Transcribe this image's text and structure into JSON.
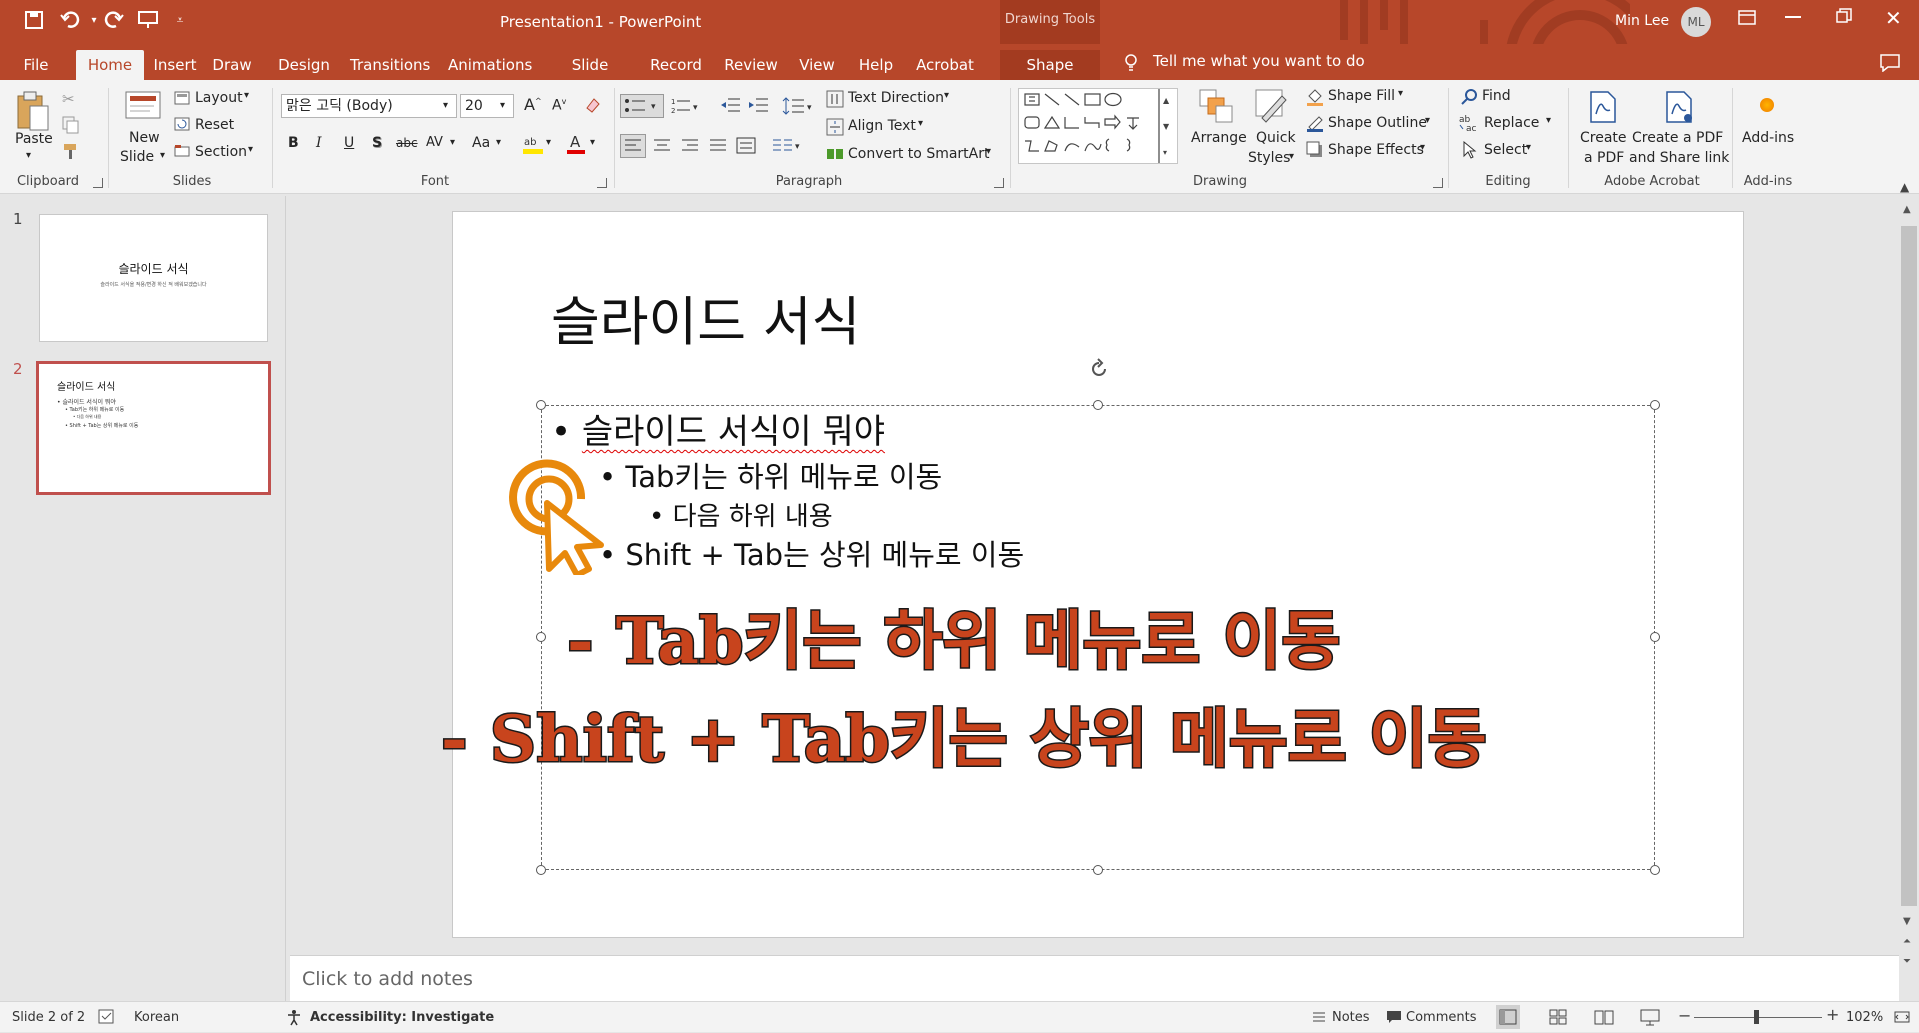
{
  "window": {
    "title": "Presentation1  -  PowerPoint",
    "context_title": "Drawing Tools",
    "user_name": "Min Lee",
    "user_initials": "ML"
  },
  "tabs": [
    "File",
    "Home",
    "Insert",
    "Draw",
    "Design",
    "Transitions",
    "Animations",
    "Slide Show",
    "Record",
    "Review",
    "View",
    "Help",
    "Acrobat",
    "Shape Format"
  ],
  "active_tab": "Home",
  "tell_me": "Tell me what you want to do",
  "ribbon": {
    "clipboard": {
      "paste": "Paste",
      "label": "Clipboard"
    },
    "slides": {
      "new_slide_1": "New",
      "new_slide_2": "Slide",
      "layout": "Layout",
      "reset": "Reset",
      "section": "Section",
      "label": "Slides"
    },
    "font": {
      "font_name": "맑은 고딕 (Body)",
      "font_size": "20",
      "label": "Font",
      "char_spacing": "AV",
      "change_case": "Aa",
      "bold": "B",
      "italic": "I",
      "underline": "U",
      "shadow": "S",
      "strike": "abc"
    },
    "paragraph": {
      "text_direction": "Text Direction",
      "align_text": "Align Text",
      "convert_smartart": "Convert to SmartArt",
      "label": "Paragraph"
    },
    "drawing": {
      "arrange": "Arrange",
      "quick_styles_1": "Quick",
      "quick_styles_2": "Styles",
      "shape_fill": "Shape Fill",
      "shape_outline": "Shape Outline",
      "shape_effects": "Shape Effects",
      "label": "Drawing"
    },
    "editing": {
      "find": "Find",
      "replace": "Replace",
      "select": "Select",
      "label": "Editing"
    },
    "acrobat": {
      "create_pdf_1": "Create",
      "create_pdf_2": "a PDF",
      "create_share_1": "Create a PDF",
      "create_share_2": "and Share link",
      "label": "Adobe Acrobat"
    },
    "addins": {
      "addins": "Add-ins",
      "label": "Add-ins"
    }
  },
  "thumbnails": [
    {
      "number": "1",
      "title": "슬라이드 서식",
      "subtitle": "슬라이드 서식을 적용/변경 하신 적 배워보겠습니다"
    },
    {
      "number": "2",
      "title": "슬라이드 서식",
      "lines": [
        "• 슬라이드 서식이 뭐야",
        "• Tab키는 하위 메뉴로 이동",
        "• 다음 하위 내용",
        "• Shift + Tab는 상위 메뉴로 이동"
      ]
    }
  ],
  "slide": {
    "title": "슬라이드 서식",
    "bullets": [
      {
        "level": 1,
        "text": "슬라이드 서식이 뭐야"
      },
      {
        "level": 2,
        "text": "Tab키는 하위 메뉴로 이동"
      },
      {
        "level": 3,
        "text": "다음 하위 내용"
      },
      {
        "level": 2,
        "text": "Shift + Tab는 상위 메뉴로 이동"
      }
    ],
    "overlay_1": "- Tab키는 하위 메뉴로 이동",
    "overlay_2": "- Shift + Tab키는 상위 메뉴로 이동"
  },
  "notes_placeholder": "Click to add notes",
  "status": {
    "slide_info": "Slide 2 of 2",
    "language": "Korean",
    "accessibility": "Accessibility: Investigate",
    "notes": "Notes",
    "comments": "Comments",
    "zoom": "102%"
  },
  "colors": {
    "accent": "#b7472a",
    "overlay_text": "#c8441d",
    "selected_thumb_border": "#c0504d",
    "cursor": "#e8890c"
  }
}
